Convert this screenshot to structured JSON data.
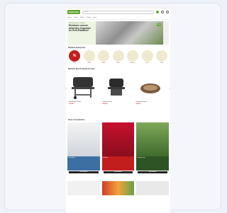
{
  "colors": {
    "brand": "#63a832",
    "sale": "#c31e1e",
    "background": "#eef1f8"
  },
  "header": {
    "logo": "Gartenxxl",
    "search_placeholder": "Suche",
    "icons": [
      "user-icon",
      "heart-icon",
      "cart-icon",
      "menu-icon"
    ]
  },
  "nav": [
    "Garten",
    "Grillen",
    "Möbel",
    "Outdoor",
    "Haus"
  ],
  "hero": {
    "small": "Die Grillsaison ist eröffnet",
    "headline": "Entdecke unsere aktuellen Angebote im Grill-Paradies!",
    "tag": "Neu"
  },
  "categories": {
    "title": "Beliebte Kategorien",
    "items": [
      {
        "label": "Sale",
        "glyph": "%"
      },
      {
        "label": "Grills",
        "glyph": ""
      },
      {
        "label": "Möbel",
        "glyph": ""
      },
      {
        "label": "Pools",
        "glyph": ""
      },
      {
        "label": "Pflanzen",
        "glyph": ""
      },
      {
        "label": "Deko",
        "glyph": ""
      },
      {
        "label": "Tools",
        "glyph": ""
      }
    ]
  },
  "products": {
    "title": "Beliebte Bay Produkte für dich",
    "items": [
      {
        "name": "Holzkohlegrill Smoker",
        "price": "199,99 €",
        "badge": ""
      },
      {
        "name": "Gasgrill Kompakt",
        "price": "149,99 €",
        "badge": "-20%"
      },
      {
        "name": "Hundebett Komfort",
        "price": "59,99 €",
        "badge": "-15%"
      }
    ]
  },
  "ideas": {
    "title": "Ideen & Inspiration",
    "items": [
      {
        "caption": "Gartenideen",
        "button": "Jetzt entdecken"
      },
      {
        "caption": "Grillideen",
        "button": "Jetzt entdecken"
      },
      {
        "caption": "Bewässerung",
        "button": "Jetzt entdecken"
      }
    ]
  }
}
